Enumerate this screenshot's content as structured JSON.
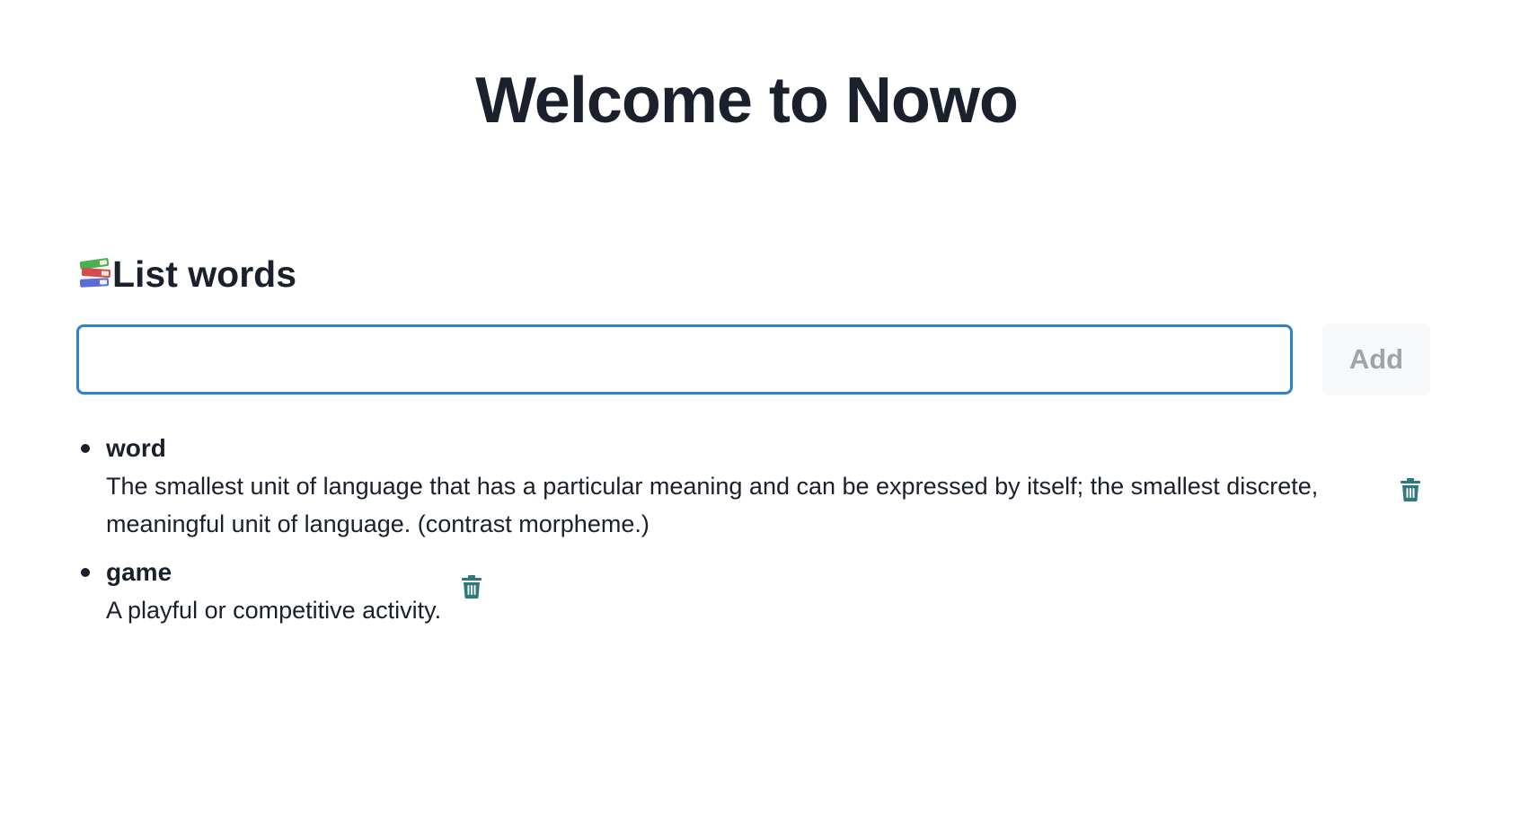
{
  "header": {
    "title": "Welcome to Nowo"
  },
  "list_section": {
    "heading_icon": "books-icon",
    "heading": "List words",
    "input": {
      "value": "",
      "placeholder": ""
    },
    "add_label": "Add",
    "add_disabled": true
  },
  "words": [
    {
      "term": "word",
      "definition": "The smallest unit of language that has a particular meaning and can be expressed by itself; the smallest discrete, meaningful unit of language. (contrast morpheme.)",
      "delete_icon": "trash-icon"
    },
    {
      "term": "game",
      "definition": "A playful or competitive activity.",
      "delete_icon": "trash-icon"
    }
  ],
  "colors": {
    "text": "#1a202c",
    "input_border": "#3182ce",
    "trash_icon": "#2c7a7b",
    "add_button_bg": "#f7f8f9",
    "add_button_text": "#a0a4a8"
  }
}
